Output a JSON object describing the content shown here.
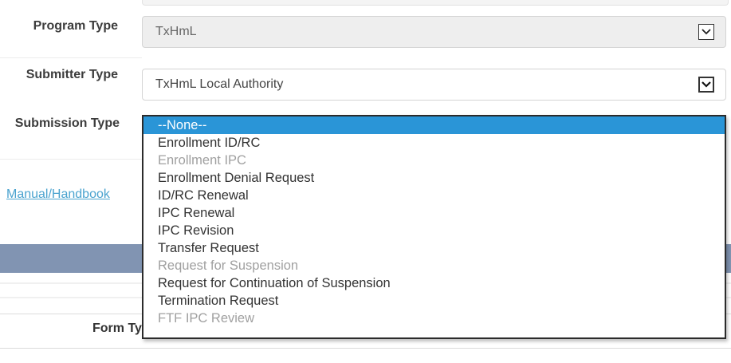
{
  "form": {
    "program_type": {
      "label": "Program Type",
      "value": "TxHmL"
    },
    "submitter_type": {
      "label": "Submitter Type",
      "value": "TxHmL Local Authority"
    },
    "submission_type": {
      "label": "Submission Type",
      "options": [
        {
          "label": "--None--",
          "state": "selected"
        },
        {
          "label": "Enrollment ID/RC",
          "state": "enabled"
        },
        {
          "label": "Enrollment IPC",
          "state": "disabled"
        },
        {
          "label": "Enrollment Denial Request",
          "state": "enabled"
        },
        {
          "label": "ID/RC Renewal",
          "state": "enabled"
        },
        {
          "label": "IPC Renewal",
          "state": "enabled"
        },
        {
          "label": "IPC Revision",
          "state": "enabled"
        },
        {
          "label": "Transfer Request",
          "state": "enabled"
        },
        {
          "label": "Request for Suspension",
          "state": "disabled"
        },
        {
          "label": "Request for Continuation of Suspension",
          "state": "enabled"
        },
        {
          "label": "Termination Request",
          "state": "enabled"
        },
        {
          "label": "FTF IPC Review",
          "state": "disabled"
        }
      ]
    }
  },
  "links": {
    "manual": "Manual/Handbook"
  },
  "table": {
    "form_type_header": "Form Ty"
  },
  "icons": {
    "dropdown": "chevron-down-icon"
  },
  "colors": {
    "selected_option": "#2a95d7",
    "band": "#8194b2",
    "link": "#4aa3cf"
  }
}
